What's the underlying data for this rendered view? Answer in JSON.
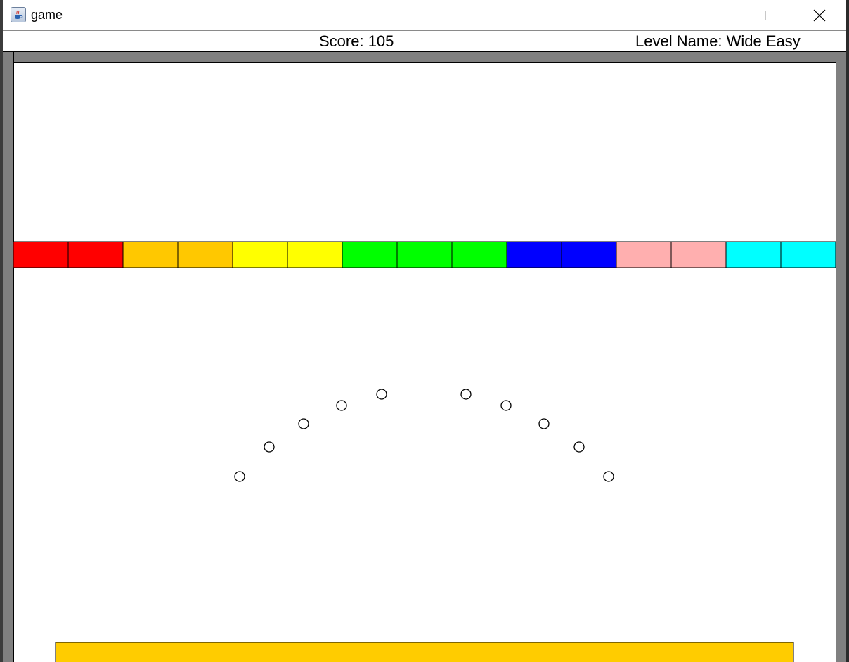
{
  "window": {
    "title": "game",
    "icon": "java-cup-icon",
    "controls": [
      "minimize-icon",
      "maximize-icon",
      "close-icon"
    ]
  },
  "hud": {
    "score_text": "Score: 105",
    "level_text": "Level Name: Wide Easy"
  },
  "colors": {
    "wall": "#808080",
    "paddle": "#ffcc00",
    "background": "#ffffff",
    "ball_outline": "#000000"
  },
  "blocks": [
    {
      "color": "#ff0000"
    },
    {
      "color": "#ff0000"
    },
    {
      "color": "#ffc800"
    },
    {
      "color": "#ffc800"
    },
    {
      "color": "#ffff00"
    },
    {
      "color": "#ffff00"
    },
    {
      "color": "#00ff00"
    },
    {
      "color": "#00ff00"
    },
    {
      "color": "#00ff00"
    },
    {
      "color": "#0000ff"
    },
    {
      "color": "#0000ff"
    },
    {
      "color": "#ffafaf"
    },
    {
      "color": "#ffafaf"
    },
    {
      "color": "#00ffff"
    },
    {
      "color": "#00ffff"
    }
  ],
  "ball_count": 10
}
